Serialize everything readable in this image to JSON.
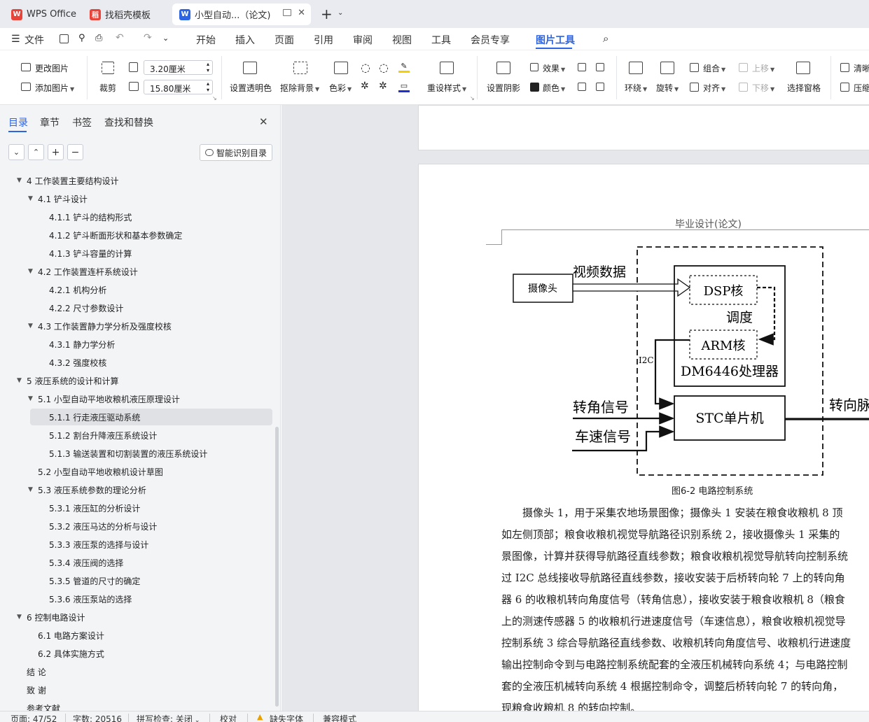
{
  "tabs": [
    {
      "label": "WPS Office",
      "logo": "W"
    },
    {
      "label": "找稻壳模板",
      "logo": "稻"
    },
    {
      "label": "小型自动...（论文)",
      "logo": "W"
    }
  ],
  "menu": {
    "file": "文件",
    "items": [
      "开始",
      "插入",
      "页面",
      "引用",
      "审阅",
      "视图",
      "工具",
      "会员专享",
      "图片工具"
    ]
  },
  "ribbon": {
    "change_image": "更改图片",
    "add_image": "添加图片",
    "crop": "裁剪",
    "height": "3.20厘米",
    "width": "15.80厘米",
    "set_transparent": "设置透明色",
    "remove_bg": "抠除背景",
    "color": "色彩",
    "reset_style": "重设样式",
    "shadow": "设置阴影",
    "effect": "效果",
    "fill_color": "颜色",
    "wrap": "环绕",
    "rotate": "旋转",
    "group": "组合",
    "align": "对齐",
    "up": "上移",
    "down": "下移",
    "select_pane": "选择窗格",
    "clarify": "清晰",
    "compress": "压缩"
  },
  "nav": {
    "tabs": [
      "目录",
      "章节",
      "书签",
      "查找和替换"
    ],
    "smart_toc": "智能识别目录",
    "items": [
      {
        "label": "4  工作装置主要结构设计",
        "level": 0,
        "expand": true
      },
      {
        "label": "4.1  铲斗设计",
        "level": 1,
        "expand": true
      },
      {
        "label": "4.1.1  铲斗的结构形式",
        "level": 2
      },
      {
        "label": "4.1.2  铲斗断面形状和基本参数确定",
        "level": 2
      },
      {
        "label": "4.1.3  铲斗容量的计算",
        "level": 2
      },
      {
        "label": "4.2  工作装置连杆系统设计",
        "level": 1,
        "expand": true
      },
      {
        "label": "4.2.1  机构分析",
        "level": 2
      },
      {
        "label": "4.2.2  尺寸参数设计",
        "level": 2
      },
      {
        "label": "4.3  工作装置静力学分析及强度校核",
        "level": 1,
        "expand": true
      },
      {
        "label": "4.3.1  静力学分析",
        "level": 2
      },
      {
        "label": "4.3.2  强度校核",
        "level": 2
      },
      {
        "label": "5  液压系统的设计和计算",
        "level": 0,
        "expand": true
      },
      {
        "label": "5.1  小型自动平地收粮机液压原理设计",
        "level": 1,
        "expand": true
      },
      {
        "label": "5.1.1  行走液压驱动系统",
        "level": 2,
        "selected": true
      },
      {
        "label": "5.1.2  割台升降液压系统设计",
        "level": 2
      },
      {
        "label": "5.1.3 输送装置和切割装置的液压系统设计",
        "level": 2
      },
      {
        "label": "5.2  小型自动平地收粮机设计草图",
        "level": 1
      },
      {
        "label": "5.3  液压系统参数的理论分析",
        "level": 1,
        "expand": true
      },
      {
        "label": "5.3.1  液压缸的分析设计",
        "level": 2
      },
      {
        "label": "5.3.2  液压马达的分析与设计",
        "level": 2
      },
      {
        "label": "5.3.3  液压泵的选择与设计",
        "level": 2
      },
      {
        "label": "5.3.4  液压阀的选择",
        "level": 2
      },
      {
        "label": "5.3.5  管道的尺寸的确定",
        "level": 2
      },
      {
        "label": "5.3.6  液压泵站的选择",
        "level": 2
      },
      {
        "label": "6  控制电路设计",
        "level": 0,
        "expand": true
      },
      {
        "label": "6.1 电路方案设计",
        "level": 1
      },
      {
        "label": "6.2 具体实施方式",
        "level": 1
      },
      {
        "label": "结    论",
        "level": 0
      },
      {
        "label": "致    谢",
        "level": 0
      },
      {
        "label": "参考文献",
        "level": 0
      }
    ]
  },
  "doc": {
    "header": "毕业设计(论文)",
    "diagram": {
      "camera": "摄像头",
      "video": "视频数据",
      "dsp": "DSP核",
      "sched": "调度",
      "arm": "ARM核",
      "i2c": "I2C",
      "proc": "DM6446处理器",
      "angle": "转角信号",
      "speed": "车速信号",
      "stc": "STC单片机",
      "out": "转向脉"
    },
    "caption": "图6-2  电路控制系统",
    "lines": [
      "　　摄像头 1，用于采集农地场景图像；摄像头 1 安装在粮食收粮机 8 顶",
      "如左侧顶部；粮食收粮机视觉导航路径识别系统 2，接收摄像头 1 采集的",
      "景图像，计算并获得导航路径直线参数；粮食收粮机视觉导航转向控制系统",
      "过 I2C 总线接收导航路径直线参数，接收安装于后桥转向轮 7 上的转向角",
      "器 6 的收粮机转向角度信号（转角信息），接收安装于粮食收粮机 8（粮食",
      "上的测速传感器 5 的收粮机行进速度信号（车速信息），粮食收粮机视觉导",
      "控制系统 3 综合导航路径直线参数、收粮机转向角度信号、收粮机行进速度",
      "输出控制命令到与电路控制系统配套的全液压机械转向系统 4；与电路控制",
      "套的全液压机械转向系统 4 根据控制命令，调整后桥转向轮 7 的转向角，",
      "现粮食收粮机 8 的转向控制。"
    ]
  },
  "status": {
    "page": "页面: 47/52",
    "words": "字数: 20516",
    "spell": "拼写检查: 关闭",
    "proof": "校对",
    "missing_font": "缺失字体",
    "compat": "兼容模式"
  }
}
